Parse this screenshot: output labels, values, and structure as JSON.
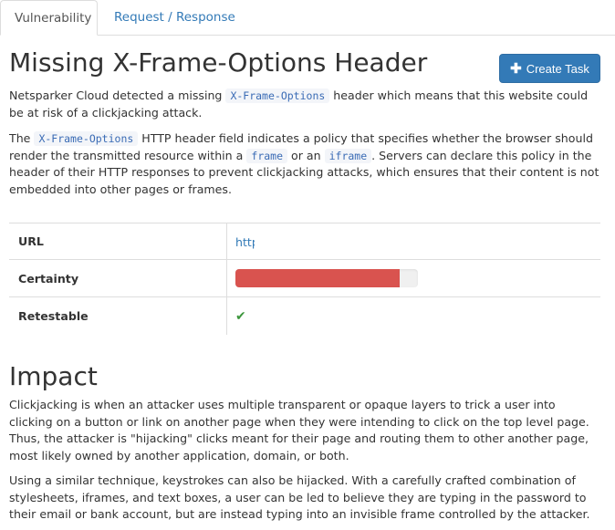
{
  "tabs": [
    {
      "label": "Vulnerability",
      "active": true
    },
    {
      "label": "Request / Response",
      "active": false
    }
  ],
  "title": "Missing X-Frame-Options Header",
  "create_task": {
    "icon": "plus-icon",
    "label": "Create Task"
  },
  "intro": {
    "pre": "Netsparker Cloud detected a missing ",
    "code": "X-Frame-Options",
    "post": " header which means that this website could be at risk of a clickjacking attack."
  },
  "description": {
    "t1": "The ",
    "c1": "X-Frame-Options",
    "t2": " HTTP header field indicates a policy that specifies whether the browser should render the transmitted resource within a ",
    "c2": "frame",
    "t3": " or an ",
    "c3": "iframe",
    "t4": ". Servers can declare this policy in the header of their HTTP responses to prevent clickjacking attacks, which ensures that their content is not embedded into other pages or frames."
  },
  "details": {
    "url_label": "URL",
    "url_value": "http",
    "certainty_label": "Certainty",
    "certainty_percent": 90,
    "retestable_label": "Retestable",
    "retestable_icon": "check-icon"
  },
  "impact": {
    "heading": "Impact",
    "p1": "Clickjacking is when an attacker uses multiple transparent or opaque layers to trick a user into clicking on a button or link on another page when they were intending to click on the top level page. Thus, the attacker is \"hijacking\" clicks meant for their page and routing them to other another page, most likely owned by another application, domain, or both.",
    "p2": "Using a similar technique, keystrokes can also be hijacked. With a carefully crafted combination of stylesheets, iframes, and text boxes, a user can be led to believe they are typing in the password to their email or bank account, but are instead typing into an invisible frame controlled by the attacker."
  },
  "colors": {
    "accent": "#337ab7",
    "danger": "#d9534f",
    "success": "#3c963c"
  }
}
